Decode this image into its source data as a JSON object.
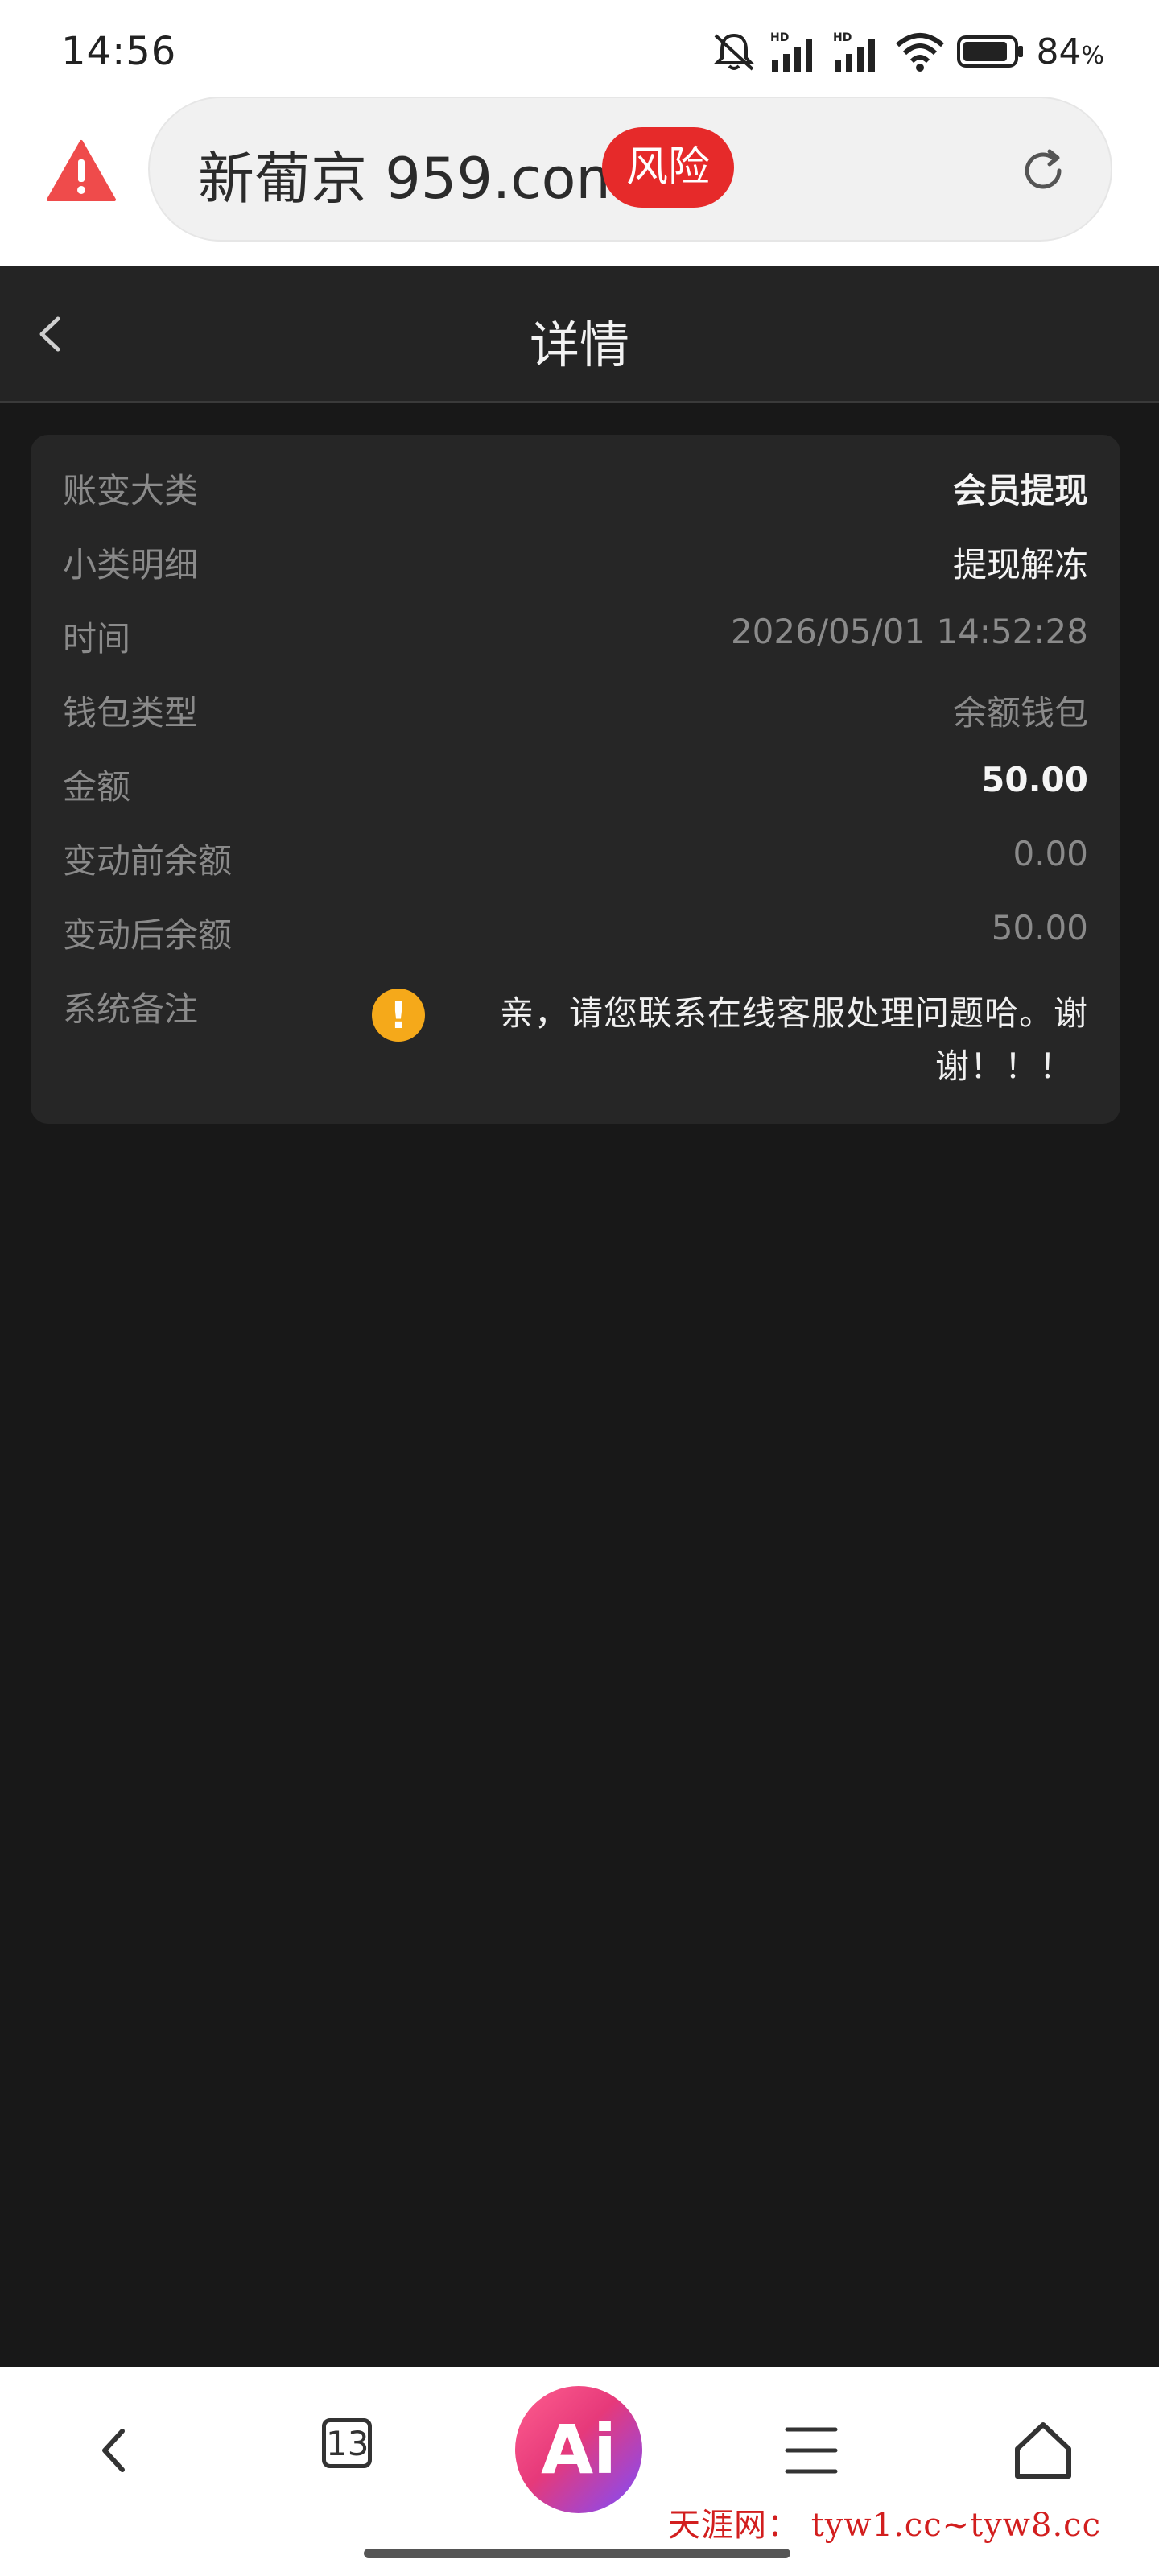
{
  "status_bar": {
    "time": "14:56",
    "battery_percent": "84",
    "battery_unit": "%",
    "hd_label": "HD",
    "icons": [
      "mute-bell-icon",
      "signal-hd-icon",
      "signal-hd-icon",
      "wifi-icon",
      "battery-icon"
    ]
  },
  "browser": {
    "url": "新葡京 959.com",
    "risk_badge": "风险",
    "warning_icon": "warning-triangle-icon",
    "refresh_icon": "refresh-icon"
  },
  "header": {
    "title": "详情",
    "back_icon": "chevron-left-icon"
  },
  "details": {
    "category_label": "账变大类",
    "category_value": "会员提现",
    "subcategory_label": "小类明细",
    "subcategory_value": "提现解冻",
    "time_label": "时间",
    "time_value": "2026/05/01 14:52:28",
    "wallet_label": "钱包类型",
    "wallet_value": "余额钱包",
    "amount_label": "金额",
    "amount_value": "50.00",
    "before_label": "变动前余额",
    "before_value": "0.00",
    "after_label": "变动后余额",
    "after_value": "50.00",
    "note_label": "系统备注",
    "note_icon_glyph": "!",
    "note_line1": "亲，请您联系在线客服处理问题哈。谢",
    "note_line2": "谢！！！"
  },
  "bottom_nav": {
    "tab_count": "13",
    "ai_label": "Ai",
    "icons": [
      "back-arrow-icon",
      "tabs-icon",
      "ai-assistant-icon",
      "menu-icon",
      "home-icon"
    ]
  },
  "watermark": "天涯网： tyw1.cc~tyw8.cc",
  "colors": {
    "page_bg": "#181818",
    "card_bg": "#262626",
    "risk_red": "#e62a2a",
    "note_orange": "#f5a91a"
  }
}
